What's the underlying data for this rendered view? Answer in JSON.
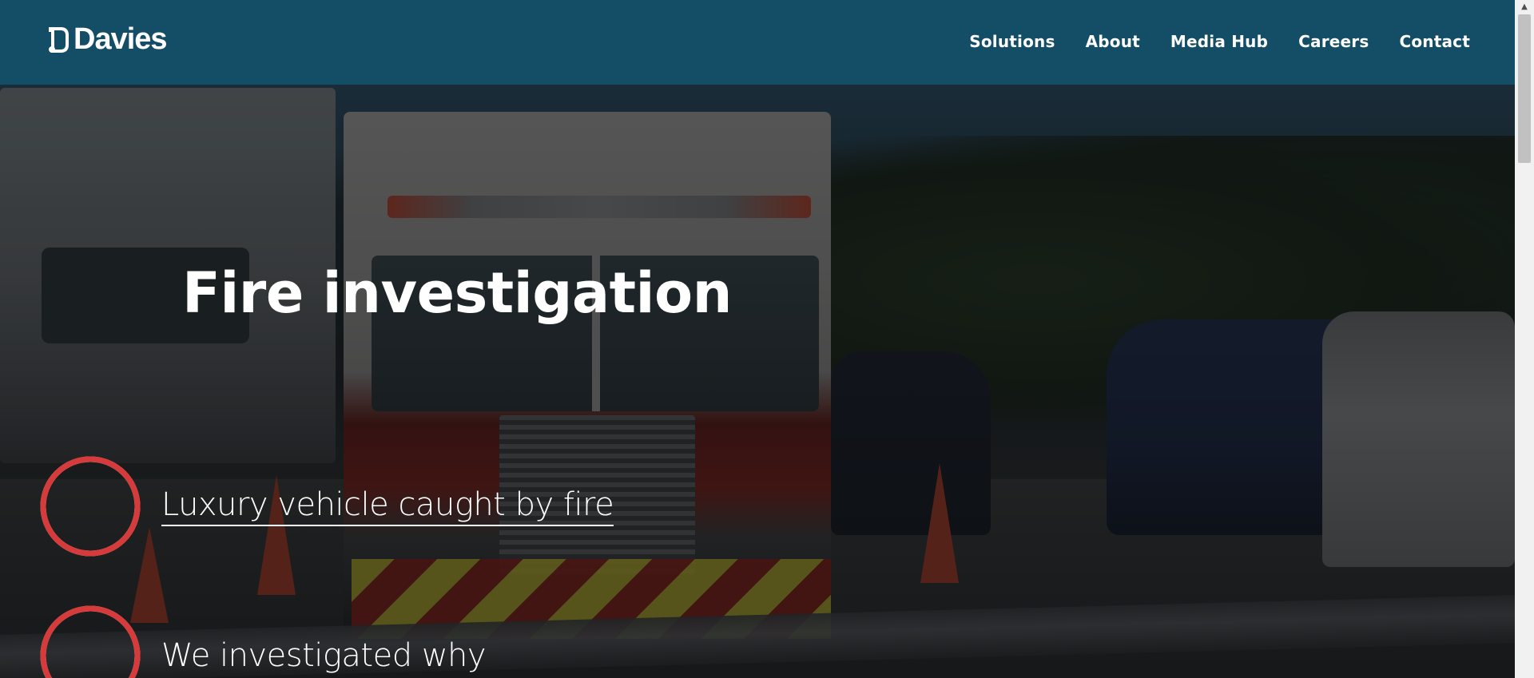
{
  "brand": {
    "name": "Davies",
    "accent": "#134e66",
    "ring_color": "#d63a3a"
  },
  "nav": {
    "items": [
      {
        "label": "Solutions"
      },
      {
        "label": "About"
      },
      {
        "label": "Media Hub"
      },
      {
        "label": "Careers"
      },
      {
        "label": "Contact"
      }
    ]
  },
  "hero": {
    "title": "Fire investigation",
    "steps": [
      {
        "label": "Luxury vehicle caught by fire",
        "progress": 1.0
      },
      {
        "label": "We investigated why",
        "progress": 0.08
      }
    ]
  },
  "icons": {
    "logo": "davies-logo-icon"
  }
}
